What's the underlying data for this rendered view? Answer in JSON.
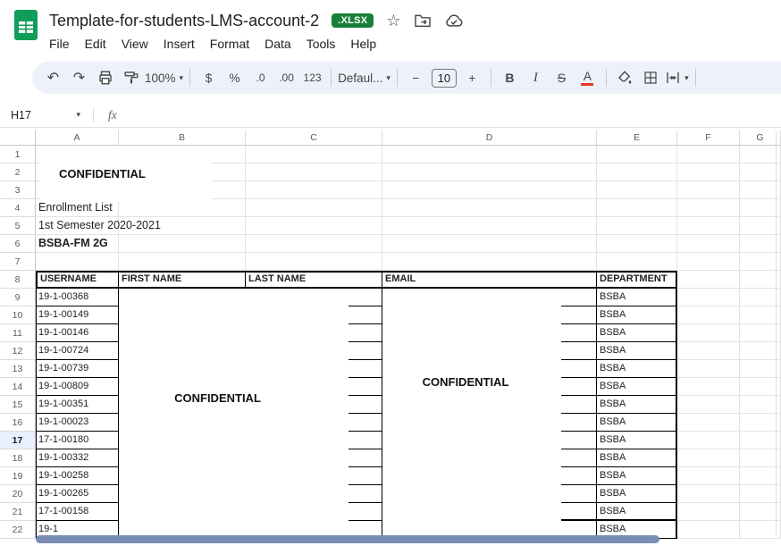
{
  "header": {
    "title": "Template-for-students-LMS-account-2",
    "badge": ".XLSX",
    "menus": [
      "File",
      "Edit",
      "View",
      "Insert",
      "Format",
      "Data",
      "Tools",
      "Help"
    ]
  },
  "toolbar": {
    "undo": "↶",
    "redo": "↷",
    "zoom": "100%",
    "currency": "$",
    "percent": "%",
    "decrease_decimal": ".0",
    "increase_decimal": ".00",
    "more_formats": "123",
    "font_name": "Defaul...",
    "minus": "−",
    "font_size": "10",
    "plus": "+",
    "bold": "B",
    "italic": "I",
    "strike": "S",
    "text_color": "A",
    "star": "☆",
    "caret": "▾"
  },
  "formula_bar": {
    "cell_ref": "H17",
    "fx_label": "fx"
  },
  "grid": {
    "columns": [
      "A",
      "B",
      "C",
      "D",
      "E",
      "F",
      "G"
    ],
    "row_count": 22,
    "selected_row": 17,
    "cells": {
      "a4": "Enrollment List",
      "a5": "1st Semester 2020-2021",
      "a6": "BSBA-FM 2G"
    },
    "table": {
      "header_row": 8,
      "headers": [
        "USERNAME",
        "FIRST NAME",
        "LAST NAME",
        "EMAIL",
        "DEPARTMENT"
      ],
      "usernames": [
        "19-1-00368",
        "19-1-00149",
        "19-1-00146",
        "19-1-00724",
        "19-1-00739",
        "19-1-00809",
        "19-1-00351",
        "19-1-00023",
        "17-1-00180",
        "19-1-00332",
        "19-1-00258",
        "19-1-00265",
        "17-1-00158",
        "19-1"
      ],
      "department_value": "BSBA"
    },
    "overlays": {
      "top": "CONFIDENTIAL",
      "names": "CONFIDENTIAL",
      "email": "CONFIDENTIAL"
    }
  },
  "colors": {
    "logo_green": "#0f9d58",
    "badge_green": "#188038",
    "text_color_indicator": "#ea3323",
    "scrollbar_thumb": "#7a8eb4",
    "selected_row_bg": "#e8f0fe",
    "table_border": "#000000"
  }
}
